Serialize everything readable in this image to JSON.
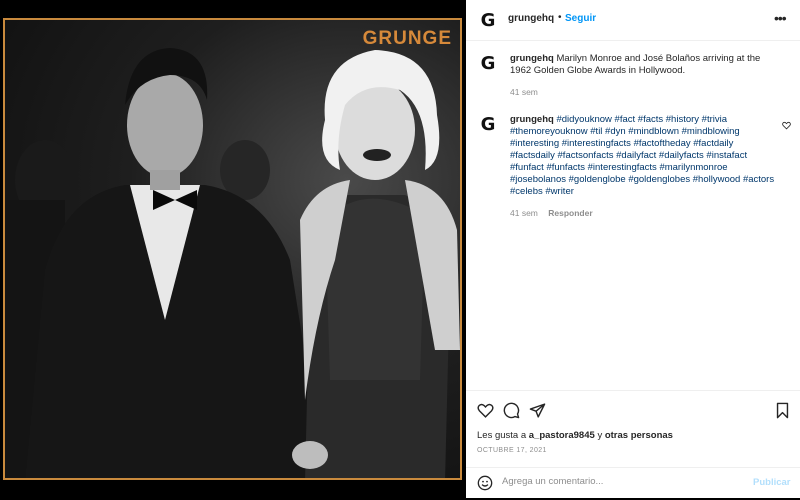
{
  "photo": {
    "brand_text": "GRUNGE"
  },
  "header": {
    "avatar_letter": "G",
    "username": "grungehq",
    "separator": "•",
    "follow_label": "Seguir",
    "more_label": "•••"
  },
  "caption": {
    "avatar_letter": "G",
    "username": "grungehq",
    "text": "Marilyn Monroe and José Bolaños arriving at the 1962 Golden Globe Awards in Hollywood.",
    "time": "41 sem"
  },
  "comment": {
    "avatar_letter": "G",
    "username": "grungehq",
    "hashtags": "#didyouknow #fact #facts #history #trivia #themoreyouknow #til #dyn #mindblown #mindblowing #interesting #interestingfacts #factoftheday #factdaily #factsdaily #factsonfacts #dailyfact #dailyfacts #instafact #funfact #funfacts #interestingfacts #marilynmonroe #josebolanos #goldenglobe #goldenglobes #hollywood #actors #celebs #writer",
    "time": "41 sem",
    "reply_label": "Responder"
  },
  "actions": {
    "likes_prefix": "Les gusta a",
    "likes_user": "a_pastora9845",
    "likes_connector": "y",
    "likes_others": "otras personas",
    "date": "OCTUBRE 17, 2021"
  },
  "comment_box": {
    "placeholder": "Agrega un comentario...",
    "publish_label": "Publicar"
  },
  "icons": [
    "heart-icon",
    "comment-icon",
    "share-icon",
    "bookmark-icon",
    "emoji-icon",
    "more-icon"
  ]
}
